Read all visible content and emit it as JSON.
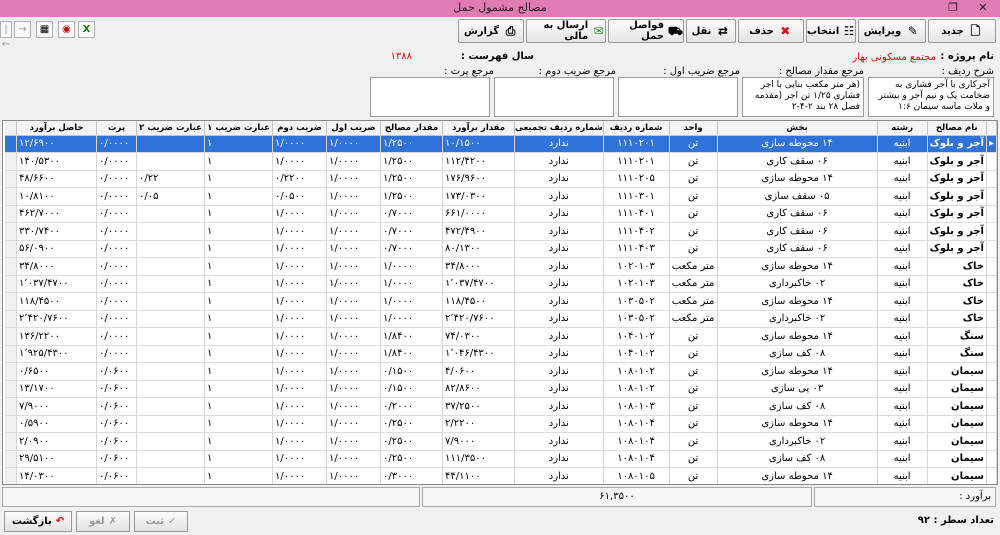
{
  "window": {
    "title": "مصالح مشمول حمل"
  },
  "toolbar": {
    "new": "جدید",
    "edit": "ویرایش",
    "select": "انتخاب",
    "delete": "حذف",
    "transfer": "نقل",
    "distances": "فواصل حمل",
    "send_finance": "ارسال به مالی",
    "report": "گزارش"
  },
  "header": {
    "project_label": "نام پروژه :",
    "project_value": "مجتمع مسکونی بهار",
    "year_label": "سال فهرست :",
    "year_value": "۱۳۸۸",
    "row_desc_label": "شرح ردیف :",
    "row_desc_text": "آجرکاری با آجر فشاری به ضخامت یک و نیم آجر و بیشتر و ملات ماسه سیمان ۱:۶",
    "ref_amount_label": "مرجع مقدار مصالح :",
    "ref_amount_text": "(هر متر مکعب بنایی با اجر فشاری ۱/۲۵ تن اجر (مقدمه فصل ۲۸ بند ۲-۴-۲",
    "ref_coef1_label": "مرجع ضریب اول :",
    "ref_coef2_label": "مرجع ضریب دوم :",
    "ref_waste_label": "مرجع پرت :"
  },
  "grid": {
    "columns": [
      "نام مصالح",
      "رشته",
      "بخش",
      "واحد",
      "شماره ردیف",
      "شماره ردیف تجمیعی",
      "مقدار برآورد",
      "مقدار مصالح",
      "ضریب اول",
      "ضریب دوم",
      "عبارت ضریب ۱",
      "عبارت ضریب ۲",
      "پرت",
      "حاصل برآورد"
    ],
    "rows": [
      [
        "آجر و بلوک",
        "ابنیه",
        "۱۴ محوطه سازی",
        "تن",
        "۱۱۱۰۲۰۱",
        "ندارد",
        "۱۰/۱۵۰۰",
        "۱/۲۵۰۰",
        "۱/۰۰۰۰",
        "۱/۰۰۰۰",
        "۱",
        "",
        "۰/۰۰۰۰",
        "۱۲/۶۹۰۰"
      ],
      [
        "آجر و بلوک",
        "ابنیه",
        "۰۶ سقف کاری",
        "تن",
        "۱۱۱۰۲۰۱",
        "ندارد",
        "۱۱۲/۴۲۰۰",
        "۱/۲۵۰۰",
        "۱/۰۰۰۰",
        "۱/۰۰۰۰",
        "۱",
        "",
        "۰/۰۰۰۰",
        "۱۴۰/۵۳۰۰"
      ],
      [
        "آجر و بلوک",
        "ابنیه",
        "۱۴ محوطه سازی",
        "تن",
        "۱۱۱۰۲۰۵",
        "ندارد",
        "۱۷۶/۹۶۰۰",
        "۱/۲۵۰۰",
        "۱/۰۰۰۰",
        "۰/۲۲۰۰",
        "۱",
        "۰/۲۲",
        "۰/۰۰۰۰",
        "۴۸/۶۶۰۰"
      ],
      [
        "آجر و بلوک",
        "ابنیه",
        "۰۵ سقف سازی",
        "تن",
        "۱۱۱۰۳۰۱",
        "ندارد",
        "۱۷۳/۰۳۰۰",
        "۱/۲۵۰۰",
        "۱/۰۰۰۰",
        "۰/۰۵۰۰",
        "۱",
        "۰/۰۵",
        "۰/۰۰۰۰",
        "۱۰/۸۱۰۰"
      ],
      [
        "آجر و بلوک",
        "ابنیه",
        "۰۶ سقف کاری",
        "تن",
        "۱۱۱۰۴۰۱",
        "ندارد",
        "۶۶۱/۰۰۰۰",
        "۰/۷۰۰۰",
        "۱/۰۰۰۰",
        "۱/۰۰۰۰",
        "۱",
        "",
        "۰/۰۰۰۰",
        "۴۶۲/۷۰۰۰"
      ],
      [
        "آجر و بلوک",
        "ابنیه",
        "۰۶ سقف کاری",
        "تن",
        "۱۱۱۰۴۰۲",
        "ندارد",
        "۴۷۲/۴۹۰۰",
        "۰/۷۰۰۰",
        "۱/۰۰۰۰",
        "۱/۰۰۰۰",
        "۱",
        "",
        "۰/۰۰۰۰",
        "۳۳۰/۷۴۰۰"
      ],
      [
        "آجر و بلوک",
        "ابنیه",
        "۰۶ سقف کاری",
        "تن",
        "۱۱۱۰۴۰۳",
        "ندارد",
        "۸۰/۱۳۰۰",
        "۰/۷۰۰۰",
        "۱/۰۰۰۰",
        "۱/۰۰۰۰",
        "۱",
        "",
        "۰/۰۰۰۰",
        "۵۶/۰۹۰۰"
      ],
      [
        "خاک",
        "ابنیه",
        "۱۴ محوطه سازی",
        "متر مکعب",
        "۱۰۲۰۱۰۳",
        "ندارد",
        "۳۴/۸۰۰۰",
        "۱/۰۰۰۰",
        "۱/۰۰۰۰",
        "۱/۰۰۰۰",
        "۱",
        "",
        "۰/۰۰۰۰",
        "۳۴/۸۰۰۰"
      ],
      [
        "خاک",
        "ابنیه",
        "۰۲ خاکبرداری",
        "متر مکعب",
        "۱۰۲۰۱۰۳",
        "ندارد",
        "۱٬۰۳۷/۴۷۰۰",
        "۱/۰۰۰۰",
        "۱/۰۰۰۰",
        "۱/۰۰۰۰",
        "۱",
        "",
        "۰/۰۰۰۰",
        "۱٬۰۳۷/۴۷۰۰"
      ],
      [
        "خاک",
        "ابنیه",
        "۱۴ محوطه سازی",
        "متر مکعب",
        "۱۰۳۰۵۰۲",
        "ندارد",
        "۱۱۸/۴۵۰۰",
        "۱/۰۰۰۰",
        "۱/۰۰۰۰",
        "۱/۰۰۰۰",
        "۱",
        "",
        "۰/۰۰۰۰",
        "۱۱۸/۴۵۰۰"
      ],
      [
        "خاک",
        "ابنیه",
        "۰۲ خاکبرداری",
        "متر مکعب",
        "۱۰۳۰۵۰۲",
        "ندارد",
        "۲٬۴۲۰/۷۶۰۰",
        "۱/۰۰۰۰",
        "۱/۰۰۰۰",
        "۱/۰۰۰۰",
        "۱",
        "",
        "۰/۰۰۰۰",
        "۲٬۴۲۰/۷۶۰۰"
      ],
      [
        "سنگ",
        "ابنیه",
        "۱۴ محوطه سازی",
        "تن",
        "۱۰۴۰۱۰۲",
        "ندارد",
        "۷۴/۰۳۰۰",
        "۱/۸۴۰۰",
        "۱/۰۰۰۰",
        "۱/۰۰۰۰",
        "۱",
        "",
        "۰/۰۰۰۰",
        "۱۳۶/۲۲۰۰"
      ],
      [
        "سنگ",
        "ابنیه",
        "۰۸ کف سازی",
        "تن",
        "۱۰۴۰۱۰۲",
        "ندارد",
        "۱٬۰۴۶/۴۳۰۰",
        "۱/۸۴۰۰",
        "۱/۰۰۰۰",
        "۱/۰۰۰۰",
        "۱",
        "",
        "۰/۰۰۰۰",
        "۱٬۹۲۵/۴۳۰۰"
      ],
      [
        "سیمان",
        "ابنیه",
        "۱۴ محوطه سازی",
        "تن",
        "۱۰۸۰۱۰۲",
        "ندارد",
        "۴/۰۶۰۰",
        "۰/۱۵۰۰",
        "۱/۰۰۰۰",
        "۱/۰۰۰۰",
        "۱",
        "",
        "۰/۰۶۰۰",
        "۰/۶۵۰۰"
      ],
      [
        "سیمان",
        "ابنیه",
        "۰۳ پی سازی",
        "تن",
        "۱۰۸۰۱۰۲",
        "ندارد",
        "۸۲/۸۶۰۰",
        "۰/۱۵۰۰",
        "۱/۰۰۰۰",
        "۱/۰۰۰۰",
        "۱",
        "",
        "۰/۰۶۰۰",
        "۱۳/۱۷۰۰"
      ],
      [
        "سیمان",
        "ابنیه",
        "۰۸ کف سازی",
        "تن",
        "۱۰۸۰۱۰۳",
        "ندارد",
        "۳۷/۲۵۰۰",
        "۰/۲۰۰۰",
        "۱/۰۰۰۰",
        "۱/۰۰۰۰",
        "۱",
        "",
        "۰/۰۶۰۰",
        "۷/۹۰۰۰"
      ],
      [
        "سیمان",
        "ابنیه",
        "۱۴ محوطه سازی",
        "تن",
        "۱۰۸۰۱۰۴",
        "ندارد",
        "۲/۲۲۰۰",
        "۰/۲۵۰۰",
        "۱/۰۰۰۰",
        "۱/۰۰۰۰",
        "۱",
        "",
        "۰/۰۶۰۰",
        "۰/۵۹۰۰"
      ],
      [
        "سیمان",
        "ابنیه",
        "۰۲ خاکبرداری",
        "تن",
        "۱۰۸۰۱۰۴",
        "ندارد",
        "۷/۹۰۰۰",
        "۰/۲۵۰۰",
        "۱/۰۰۰۰",
        "۱/۰۰۰۰",
        "۱",
        "",
        "۰/۰۶۰۰",
        "۲/۰۹۰۰"
      ],
      [
        "سیمان",
        "ابنیه",
        "۰۸ کف سازی",
        "تن",
        "۱۰۸۰۱۰۴",
        "ندارد",
        "۱۱۱/۳۵۰۰",
        "۰/۲۵۰۰",
        "۱/۰۰۰۰",
        "۱/۰۰۰۰",
        "۱",
        "",
        "۰/۰۶۰۰",
        "۲۹/۵۱۰۰"
      ],
      [
        "سیمان",
        "ابنیه",
        "۱۴ محوطه سازی",
        "تن",
        "۱۰۸۰۱۰۵",
        "ندارد",
        "۴۴/۱۱۰۰",
        "۰/۳۰۰۰",
        "۱/۰۰۰۰",
        "۱/۰۰۰۰",
        "۱",
        "",
        "۰/۰۶۰۰",
        "۱۴/۰۳۰۰"
      ]
    ]
  },
  "footer": {
    "total_label": "برآورد :",
    "total_value": "۶۱,۳۵۰۰",
    "row_count_label": "تعداد سطر :",
    "row_count_value": "۹۲",
    "save": "ثبت",
    "cancel": "لغو",
    "back": "بازگشت"
  },
  "colors": {
    "titlebar": "#e07bb6",
    "selected_row": "#2f73d8",
    "accent_red": "#d11111"
  }
}
